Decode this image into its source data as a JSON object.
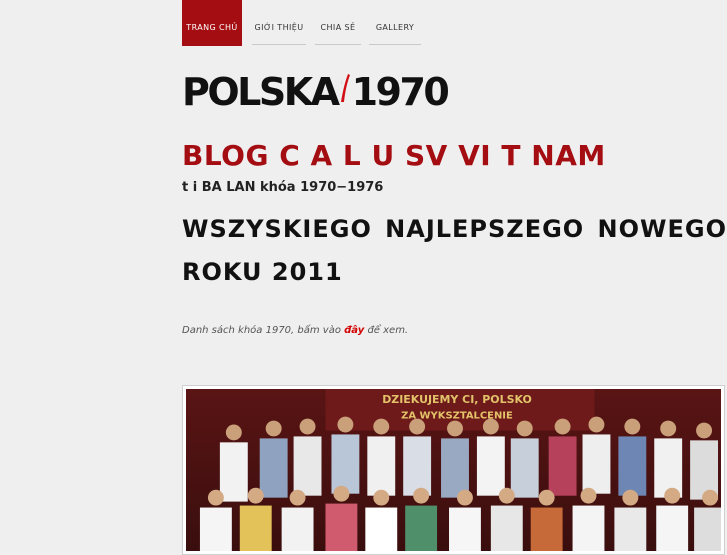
{
  "nav": {
    "items": [
      {
        "label": "Trang chủ",
        "active": true
      },
      {
        "label": "Giới thiệu",
        "active": false
      },
      {
        "label": "Chia sẻ",
        "active": false
      },
      {
        "label": "Gallery",
        "active": false
      }
    ]
  },
  "logo": {
    "left_text": "POLSKA",
    "right_text": "1970",
    "flag_icon": "polish-flag-stroke-icon"
  },
  "blog": {
    "title": "BLOG C A L U SV VI T NAM",
    "subtitle": "t i BA LAN khóa 1970−1976"
  },
  "headline": {
    "words_line1": [
      "WSZYSKIEGO",
      "NAJLEPSZEGO",
      "NOWEGO"
    ],
    "line2": "ROKU 2011"
  },
  "note": {
    "before": "Danh sách khóa 1970, bấm vào ",
    "link": "đây",
    "after": " để xem."
  },
  "photo": {
    "banner_line1": "DZIEKUJEMY CI, POLSKO",
    "banner_line2": "ZA WYKSZTALCENIE"
  },
  "colors": {
    "accent": "#a40d12",
    "link": "#d40000",
    "background": "#efefef"
  }
}
